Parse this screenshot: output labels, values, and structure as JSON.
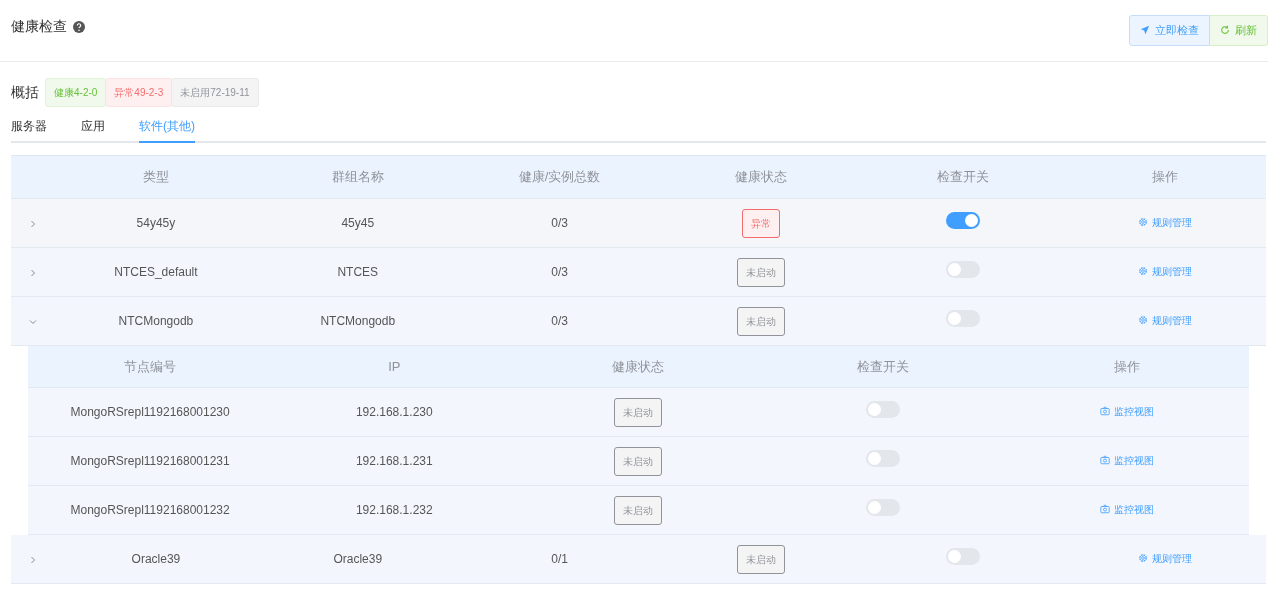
{
  "page": {
    "title": "健康检查",
    "actions": [
      {
        "kind": "check",
        "label": "立即检查"
      },
      {
        "kind": "refresh",
        "label": "刷新"
      }
    ]
  },
  "summary": {
    "label": "概括",
    "tags": [
      {
        "kind": "healthy",
        "text": "健康4-2-0"
      },
      {
        "kind": "abnormal",
        "text": "异常49-2-3"
      },
      {
        "kind": "disabled",
        "text": "未启用72-19-11"
      }
    ]
  },
  "tabs": [
    {
      "label": "服务器",
      "selected": false
    },
    {
      "label": "应用",
      "selected": false
    },
    {
      "label": "软件(其他)",
      "selected": true
    }
  ],
  "table": {
    "columns": [
      "类型",
      "群组名称",
      "健康/实例总数",
      "健康状态",
      "检查开关",
      "操作"
    ],
    "rows": [
      {
        "type": "54y45y",
        "group": "45y45",
        "count": "0/3",
        "status": {
          "kind": "abnormal",
          "text": "异常"
        },
        "on": true,
        "action": "规则管理",
        "expanded": false
      },
      {
        "type": "NTCES_default",
        "group": "NTCES",
        "count": "0/3",
        "status": {
          "kind": "disabled",
          "text": "未启动"
        },
        "on": false,
        "action": "规则管理",
        "expanded": false
      },
      {
        "type": "NTCMongodb",
        "group": "NTCMongodb",
        "count": "0/3",
        "status": {
          "kind": "disabled",
          "text": "未启动"
        },
        "on": false,
        "action": "规则管理",
        "expanded": true,
        "detail": {
          "columns": [
            "节点编号",
            "IP",
            "健康状态",
            "检查开关",
            "操作"
          ],
          "rows": [
            {
              "node": "MongoRSrepl1192168001230",
              "ip": "192.168.1.230",
              "status": {
                "kind": "disabled",
                "text": "未启动"
              },
              "on": false,
              "action": "监控视图"
            },
            {
              "node": "MongoRSrepl1192168001231",
              "ip": "192.168.1.231",
              "status": {
                "kind": "disabled",
                "text": "未启动"
              },
              "on": false,
              "action": "监控视图"
            },
            {
              "node": "MongoRSrepl1192168001232",
              "ip": "192.168.1.232",
              "status": {
                "kind": "disabled",
                "text": "未启动"
              },
              "on": false,
              "action": "监控视图"
            }
          ]
        }
      },
      {
        "type": "Oracle39",
        "group": "Oracle39",
        "count": "0/1",
        "status": {
          "kind": "disabled",
          "text": "未启动"
        },
        "on": false,
        "action": "规则管理",
        "expanded": false
      }
    ]
  }
}
